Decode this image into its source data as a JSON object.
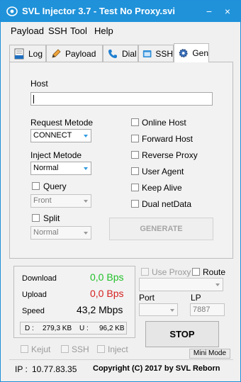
{
  "window": {
    "title": "SVL Injector 3.7 - Test No Proxy.svi"
  },
  "menu": [
    "Payload",
    "SSH",
    "Tool",
    "Help"
  ],
  "tabs": [
    "Log",
    "Payload",
    "Dial",
    "SSH",
    "Gen"
  ],
  "gen": {
    "host_label": "Host",
    "host_value": "",
    "request_method_label": "Request Metode",
    "request_method_value": "CONNECT",
    "inject_method_label": "Inject Metode",
    "inject_method_value": "Normal",
    "query_label": "Query",
    "query_position": "Front",
    "split_label": "Split",
    "split_value": "Normal",
    "options": [
      "Online Host",
      "Forward Host",
      "Reverse Proxy",
      "User Agent",
      "Keep Alive",
      "Dual netData"
    ],
    "generate_label": "GENERATE"
  },
  "stats": {
    "download_label": "Download",
    "download_value": "0,0 Bps",
    "upload_label": "Upload",
    "upload_value": "0,0 Bps",
    "speed_label": "Speed",
    "speed_value": "43,2 Mbps",
    "d_label": "D :",
    "d_value": "279,3 KB",
    "u_label": "U :",
    "u_value": "96,2 KB"
  },
  "proxy": {
    "use_proxy_label": "Use Proxy",
    "route_label": "Route",
    "port_label": "Port",
    "lp_label": "LP",
    "lp_value": "7887",
    "stop_label": "STOP",
    "mini_mode_label": "Mini Mode"
  },
  "bottom": {
    "kejut_label": "Kejut",
    "ssh_label": "SSH",
    "inject_label": "Inject",
    "ip_label": "IP :",
    "ip_value": "10.77.83.35",
    "copyright": "Copyright (C) 2017 by SVL Reborn"
  },
  "colors": {
    "titlebar": "#1f92da",
    "download": "#22c12a",
    "upload": "#d62020"
  }
}
